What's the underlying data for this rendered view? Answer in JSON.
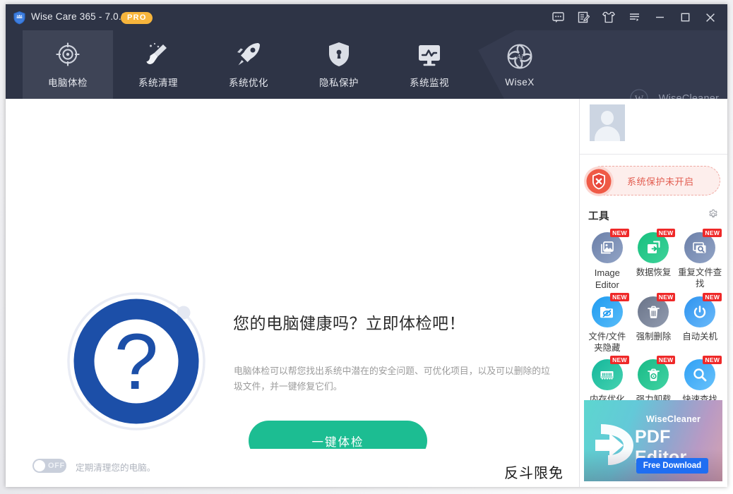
{
  "titlebar": {
    "app_title": "Wise Care 365 - 7.0.2",
    "pro_badge": "PRO",
    "buttons": [
      {
        "name": "feedback-icon",
        "label": "feedback"
      },
      {
        "name": "checklist-icon",
        "label": "checklist"
      },
      {
        "name": "skin-icon",
        "label": "skin"
      },
      {
        "name": "menu-icon",
        "label": "menu"
      },
      {
        "name": "minimize-icon",
        "label": "minimize"
      },
      {
        "name": "maximize-icon",
        "label": "maximize"
      },
      {
        "name": "close-icon",
        "label": "close"
      }
    ]
  },
  "nav": {
    "items": [
      {
        "label": "电脑体检",
        "icon": "target-icon",
        "active": true
      },
      {
        "label": "系统清理",
        "icon": "broom-icon",
        "active": false
      },
      {
        "label": "系统优化",
        "icon": "rocket-icon",
        "active": false
      },
      {
        "label": "隐私保护",
        "icon": "shield-keyhole-icon",
        "active": false
      },
      {
        "label": "系统监视",
        "icon": "monitor-icon",
        "active": false
      },
      {
        "label": "WiseX",
        "icon": "ai-swirl-icon",
        "active": false
      }
    ],
    "brand": "WiseCleaner"
  },
  "main": {
    "hero_graphic": "question-mark-ring",
    "title": "您的电脑健康吗？立即体检吧！",
    "description": "电脑体检可以帮您找出系统中潜在的安全问题、可优化项目，以及可以删除的垃圾文件，并一键修复它们。",
    "scan_button": "一键体检",
    "toggle_state": "OFF",
    "toggle_text": "定期清理您的电脑。",
    "watermark": "反斗限免"
  },
  "sidebar": {
    "avatar": "user-avatar",
    "protection_status": "系统保护未开启",
    "tools_title": "工具",
    "settings_icon": "gear-icon",
    "tools": [
      {
        "label": "Image Editor",
        "icon": "image-editor-icon",
        "color": "#6b7fa8",
        "color2": "#8b9ec2",
        "badge": "NEW",
        "en": true
      },
      {
        "label": "数据恢复",
        "icon": "data-recovery-icon",
        "color": "#17c07e",
        "color2": "#39cf93",
        "badge": "NEW",
        "en": false
      },
      {
        "label": "重复文件查找",
        "icon": "duplicate-finder-icon",
        "color": "#6b7fa8",
        "color2": "#8b9ec2",
        "badge": "NEW",
        "en": false
      },
      {
        "label": "文件/文件夹隐藏",
        "icon": "hide-folder-icon",
        "color": "#1f9bf0",
        "color2": "#52b7f7",
        "badge": "NEW",
        "en": false
      },
      {
        "label": "强制删除",
        "icon": "force-delete-icon",
        "color": "#6a7488",
        "color2": "#8d97ab",
        "badge": "NEW",
        "en": false
      },
      {
        "label": "自动关机",
        "icon": "auto-shutdown-icon",
        "color": "#2e93ef",
        "color2": "#63b5f7",
        "badge": "NEW",
        "en": false
      },
      {
        "label": "内存优化",
        "icon": "memory-optimize-icon",
        "color": "#14b79b",
        "color2": "#3fcfae",
        "badge": "NEW",
        "en": false
      },
      {
        "label": "强力卸载",
        "icon": "force-uninstall-icon",
        "color": "#18ba86",
        "color2": "#3ed0a0",
        "badge": "NEW",
        "en": false
      },
      {
        "label": "快速查找",
        "icon": "quick-search-icon",
        "color": "#2fa0f5",
        "color2": "#62bdfb",
        "badge": "NEW",
        "en": false
      }
    ],
    "banner": {
      "brand": "WiseCleaner",
      "title": "PDF Editor",
      "button": "Free Download",
      "logo": "pdf-arrow-logo"
    }
  },
  "colors": {
    "header_bg": "#2e3446",
    "header_active": "#3e4456",
    "accent_green": "#1cbd92",
    "accent_blue": "#1c4fa8",
    "badge_orange": "#f7b53c",
    "badge_red": "#ef2929",
    "alert_red": "#e25c4f",
    "banner_blue": "#1f6ef2"
  }
}
